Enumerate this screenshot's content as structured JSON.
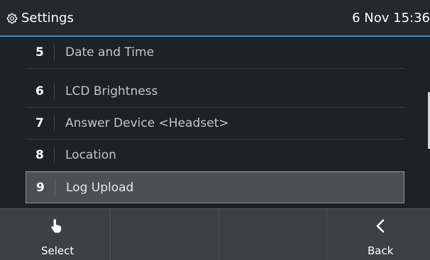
{
  "header": {
    "title": "Settings",
    "datetime": "6 Nov 15:36",
    "icon": "gear-icon",
    "accent_color": "#2f93c7"
  },
  "menu": {
    "items": [
      {
        "number": "5",
        "label": "Date and Time",
        "selected": false
      },
      {
        "number": "6",
        "label": "LCD Brightness",
        "selected": false
      },
      {
        "number": "7",
        "label": "Answer Device <Headset>",
        "selected": false
      },
      {
        "number": "8",
        "label": "Location",
        "selected": false
      },
      {
        "number": "9",
        "label": "Log Upload",
        "selected": true
      }
    ]
  },
  "softkeys": {
    "select": {
      "label": "Select",
      "icon": "touch-hand-icon"
    },
    "back": {
      "label": "Back",
      "icon": "chevron-left-icon"
    }
  }
}
